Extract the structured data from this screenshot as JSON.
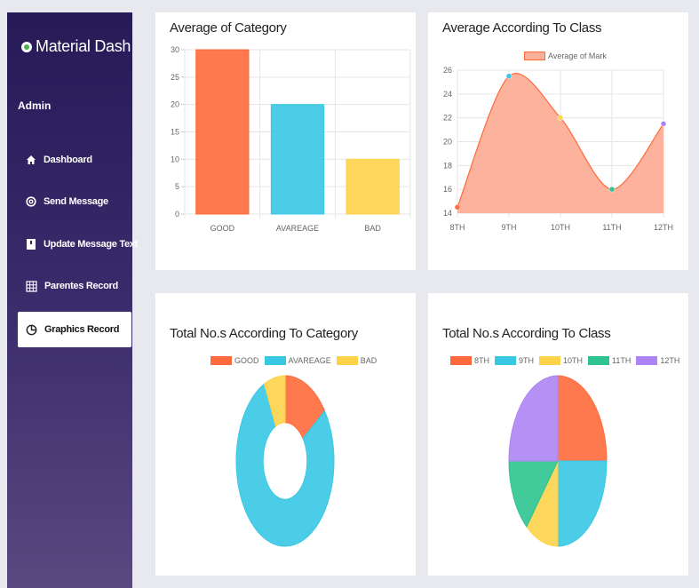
{
  "app": {
    "brand": "Material Dash",
    "role": "Admin"
  },
  "sidebar": {
    "items": [
      {
        "label": "Dashboard",
        "icon": "home-icon",
        "active": false
      },
      {
        "label": "Send Message",
        "icon": "at-icon",
        "active": false
      },
      {
        "label": "Update Message Text",
        "icon": "document-icon",
        "active": false
      },
      {
        "label": "Parentes Record",
        "icon": "grid-icon",
        "active": false
      },
      {
        "label": "Graphics Record",
        "icon": "pie-chart-icon",
        "active": true
      }
    ]
  },
  "colors": {
    "orange": "#fe6a3b",
    "cyan": "#38c8e4",
    "yellow": "#fdd349",
    "green": "#2fc48f",
    "purple": "#ad84f4",
    "salmon": "#fcae98"
  },
  "cards": [
    {
      "title": "Average of Category"
    },
    {
      "title": "Average According To Class"
    },
    {
      "title": "Total No.s According To Category"
    },
    {
      "title": "Total No.s According To Class"
    }
  ],
  "chart_data": [
    {
      "type": "bar",
      "title": "Average of Category",
      "categories": [
        "GOOD",
        "AVAREAGE",
        "BAD"
      ],
      "values": [
        30,
        20,
        10
      ],
      "colors": [
        "#fe6a3b",
        "#38c8e4",
        "#fdd349"
      ],
      "ylim": [
        0,
        30
      ],
      "yticks": [
        "0",
        "5",
        "10",
        "15",
        "20",
        "25",
        "30"
      ],
      "grid": true
    },
    {
      "type": "area",
      "title": "Average According To Class",
      "legend": "Average of Mark",
      "categories": [
        "8TH",
        "9TH",
        "10TH",
        "11TH",
        "12TH"
      ],
      "values": [
        14.5,
        25.5,
        22,
        16,
        21.5
      ],
      "point_colors": [
        "#fe6a3b",
        "#38c8e4",
        "#fdd349",
        "#2fc48f",
        "#ad84f4"
      ],
      "ylim": [
        14,
        26
      ],
      "yticks": [
        "14",
        "16",
        "18",
        "20",
        "22",
        "24",
        "26"
      ],
      "grid": true
    },
    {
      "type": "pie",
      "variant": "doughnut",
      "title": "Total No.s According To Category",
      "labels": [
        "GOOD",
        "AVAREAGE",
        "BAD"
      ],
      "values": [
        15,
        78,
        7
      ],
      "colors": [
        "#fe6a3b",
        "#38c8e4",
        "#fdd349"
      ],
      "legend_position": "top"
    },
    {
      "type": "pie",
      "title": "Total No.s According To Class",
      "labels": [
        "8TH",
        "9TH",
        "10TH",
        "11TH",
        "12TH"
      ],
      "values": [
        25,
        25,
        11,
        14,
        25
      ],
      "colors": [
        "#fe6a3b",
        "#38c8e4",
        "#fdd349",
        "#2fc48f",
        "#ad84f4"
      ],
      "legend_position": "top"
    }
  ]
}
